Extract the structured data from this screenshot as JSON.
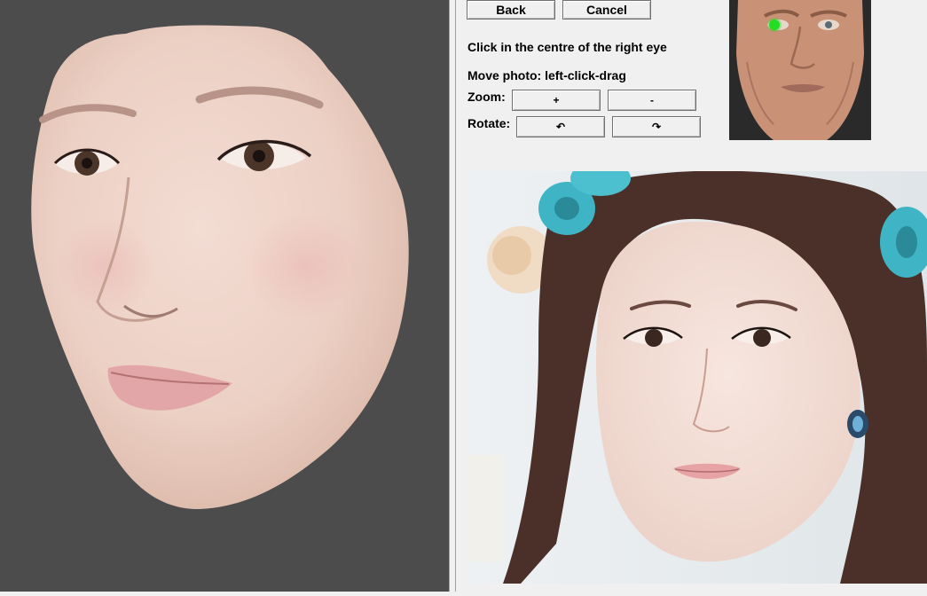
{
  "controls": {
    "back_label": "Back",
    "cancel_label": "Cancel",
    "instruction": "Click in the centre of the right eye",
    "move_hint": "Move photo: left-click-drag",
    "zoom_label": "Zoom:",
    "zoom_in_label": "+",
    "zoom_out_label": "-",
    "rotate_label": "Rotate:",
    "rotate_ccw_label": "↶",
    "rotate_cw_label": "↷"
  },
  "colors": {
    "viewport_bg": "#4c4c4c",
    "panel_bg": "#f0f0f0",
    "eye_marker": "#22dd22"
  },
  "icons": {
    "eye_marker": "green-dot-icon",
    "rotate_ccw": "rotate-ccw-icon",
    "rotate_cw": "rotate-cw-icon"
  }
}
